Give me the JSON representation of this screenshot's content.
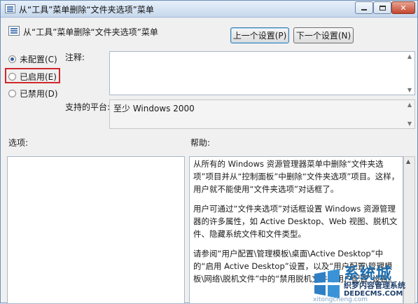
{
  "window": {
    "title": "从“工具”菜单删除“文件夹选项”菜单"
  },
  "header": {
    "title": "从“工具”菜单删除“文件夹选项”菜单",
    "prev_button": "上一个设置(P)",
    "next_button": "下一个设置(N)"
  },
  "state": {
    "options": [
      {
        "label": "未配置(C)",
        "selected": true
      },
      {
        "label": "已启用(E)",
        "selected": false,
        "highlighted": true
      },
      {
        "label": "已禁用(D)",
        "selected": false
      }
    ]
  },
  "comment": {
    "label": "注释:",
    "value": ""
  },
  "platform": {
    "label": "支持的平台:",
    "value": "至少 Windows 2000"
  },
  "options_panel": {
    "label": "选项:"
  },
  "help": {
    "label": "帮助:",
    "paragraphs": [
      "从所有的 Windows 资源管理器菜单中删除“文件夹选项”项目并从“控制面板”中删除“文件夹选项”项目。这样，用户就不能使用“文件夹选项”对话框了。",
      "用户可通过“文件夹选项”对话框设置 Windows 资源管理器的许多属性，如 Active Desktop、Web 视图、脱机文件、隐藏系统文件和文件类型。",
      "请参阅“用户配置\\管理模板\\桌面\\Active Desktop”中的“启用 Active Desktop”设置，以及“用户配置\\管理模板\\网络\\脱机文件”中的“禁用脱机文件的用户配置”设置。"
    ]
  },
  "watermark": {
    "brand": "系统城",
    "tagline": "织梦内容管理系统",
    "url": "DEDECMS.COM",
    "site": "xitongcheng.com"
  },
  "colors": {
    "highlight_border": "#d0282c",
    "accent": "#2d5fa0",
    "watermark_blue": "#1f6fb0"
  }
}
